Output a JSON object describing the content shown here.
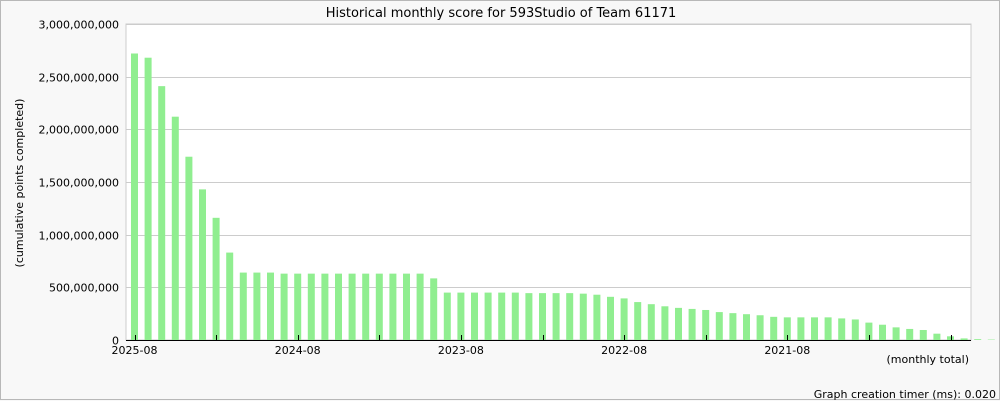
{
  "chart_data": {
    "type": "bar",
    "title": "Historical monthly score for 593Studio of Team 61171",
    "ylabel": "(cumulative points completed)",
    "xlabel": "(monthly total)",
    "footer": "Graph creation timer (ms): 0.020",
    "ylim": [
      0,
      3000000000
    ],
    "yticks": [
      0,
      500000000,
      1000000000,
      1500000000,
      2000000000,
      2500000000,
      3000000000
    ],
    "ytick_labels": [
      "0",
      "500,000,000",
      "1,000,000,000",
      "1,500,000,000",
      "2,000,000,000",
      "2,500,000,000",
      "3,000,000,000"
    ],
    "xtick_labels": [
      {
        "label": "2025-08",
        "index": 0
      },
      {
        "label": "2024-08",
        "index": 12
      },
      {
        "label": "2023-08",
        "index": 24
      },
      {
        "label": "2022-08",
        "index": 36
      },
      {
        "label": "2021-08",
        "index": 48
      }
    ],
    "grid": true,
    "bar_color": "#90ee90",
    "values": [
      2720000000,
      2680000000,
      2410000000,
      2120000000,
      1740000000,
      1430000000,
      1160000000,
      830000000,
      640000000,
      640000000,
      640000000,
      630000000,
      630000000,
      630000000,
      630000000,
      630000000,
      630000000,
      630000000,
      630000000,
      630000000,
      630000000,
      630000000,
      585000000,
      450000000,
      450000000,
      450000000,
      450000000,
      450000000,
      450000000,
      445000000,
      445000000,
      445000000,
      445000000,
      440000000,
      430000000,
      410000000,
      395000000,
      360000000,
      340000000,
      320000000,
      305000000,
      295000000,
      285000000,
      265000000,
      255000000,
      245000000,
      235000000,
      220000000,
      215000000,
      215000000,
      215000000,
      215000000,
      205000000,
      195000000,
      165000000,
      145000000,
      120000000,
      105000000,
      95000000,
      60000000,
      35000000,
      15000000,
      8000000,
      4000000
    ]
  }
}
